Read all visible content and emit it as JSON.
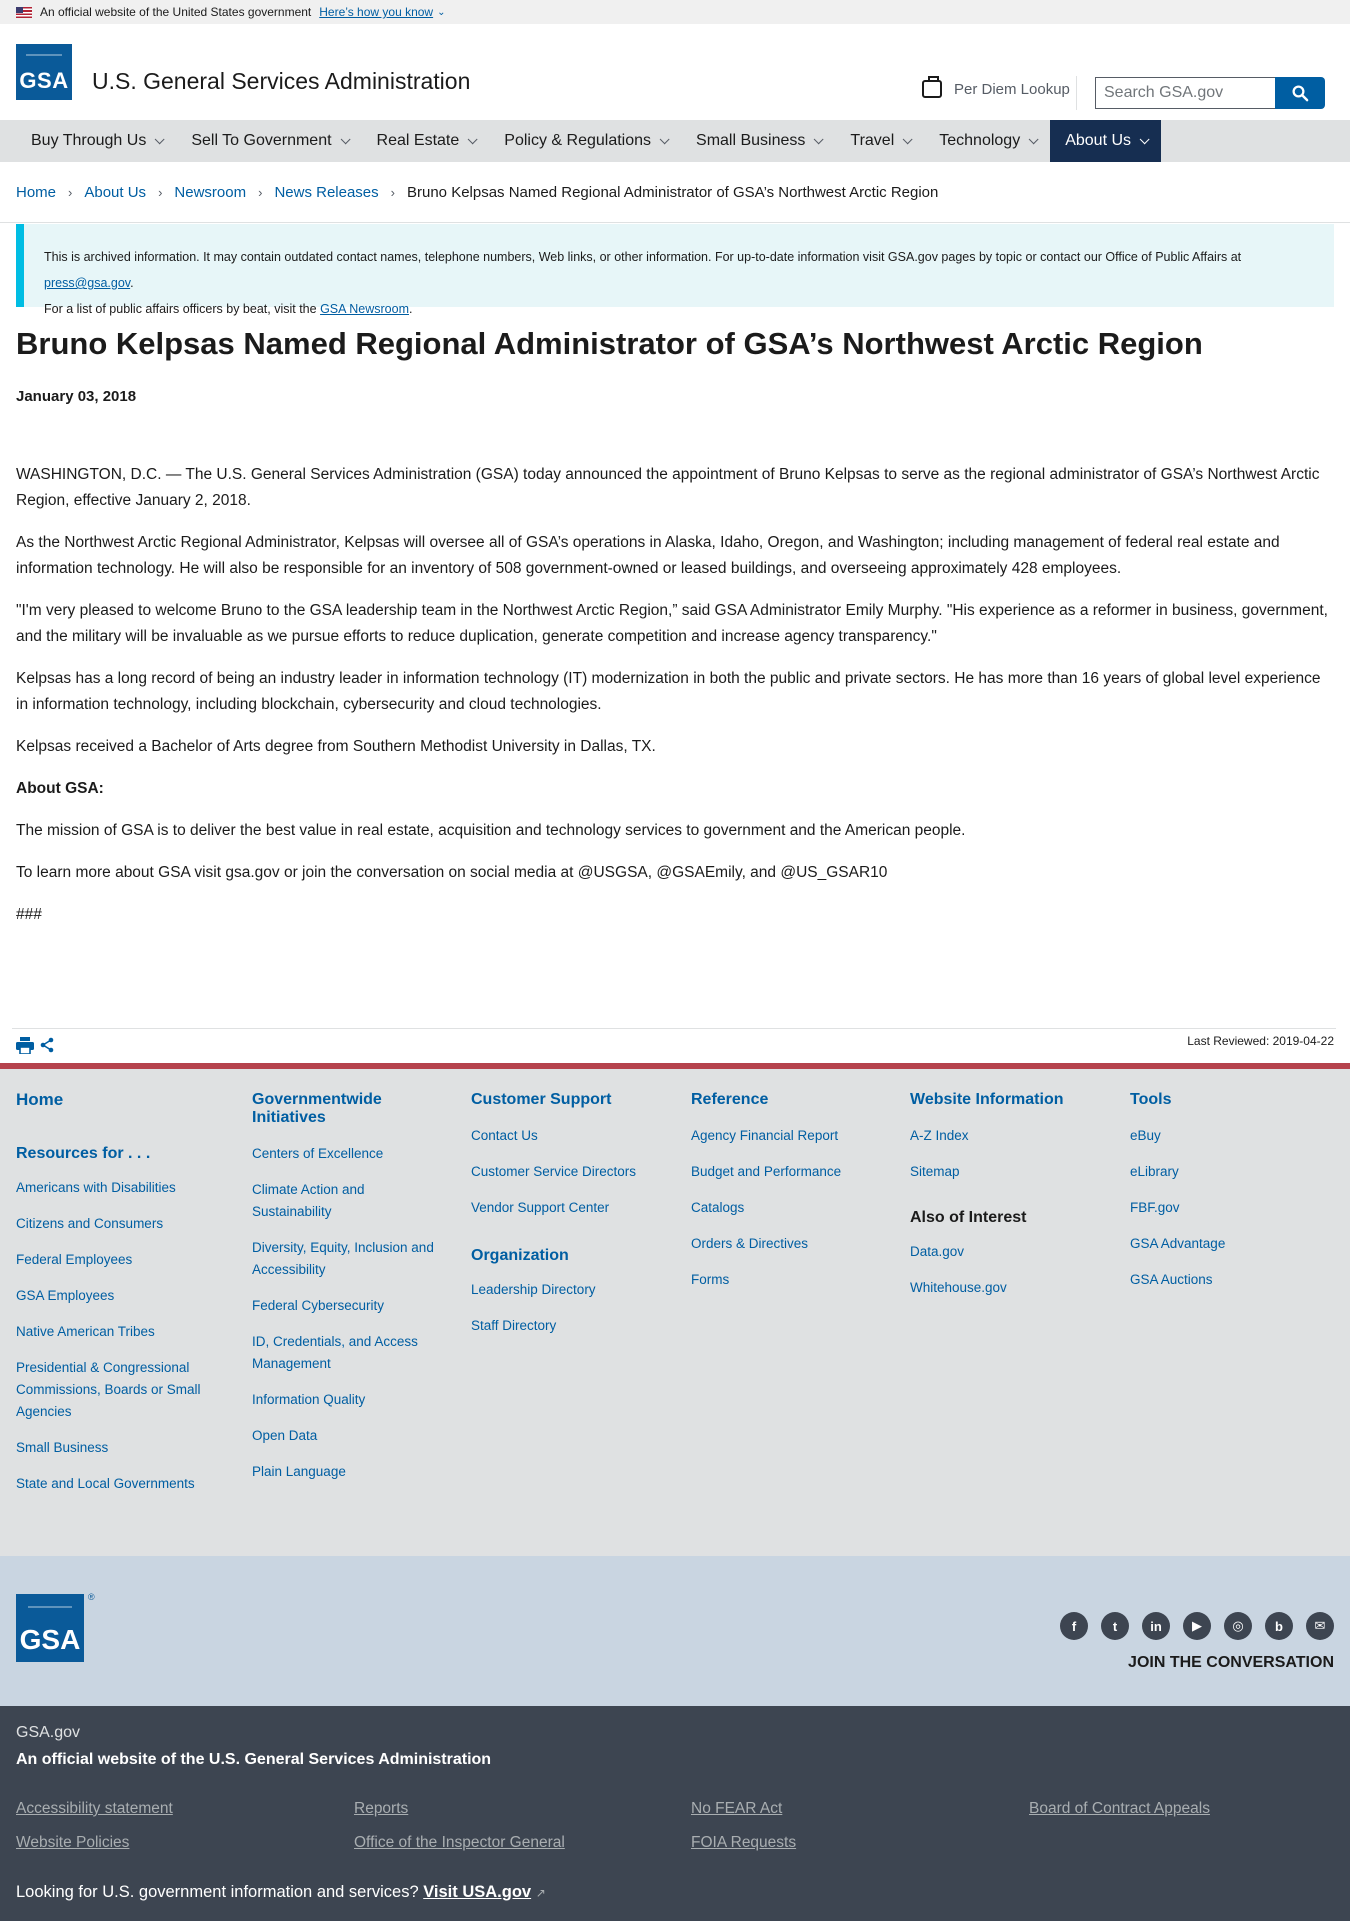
{
  "banner": {
    "text": "An official website of the United States government",
    "link": "Here’s how you know"
  },
  "header": {
    "logo_text": "GSA",
    "agency_name": "U.S. General Services Administration",
    "per_diem": "Per Diem Lookup",
    "search_placeholder": "Search GSA.gov"
  },
  "nav": {
    "items": [
      "Buy Through Us",
      "Sell To Government",
      "Real Estate",
      "Policy & Regulations",
      "Small Business",
      "Travel",
      "Technology",
      "About Us"
    ],
    "active": "About Us"
  },
  "breadcrumb": {
    "items": [
      "Home",
      "About Us",
      "Newsroom",
      "News Releases"
    ],
    "current": "Bruno Kelpsas Named Regional Administrator of GSA’s Northwest Arctic Region"
  },
  "alert": {
    "line1": "This is archived information. It may contain outdated contact names, telephone numbers, Web links, or other information. For up-to-date information visit GSA.gov pages by topic or contact our Office of Public Affairs at",
    "email": "press@gsa.gov",
    "line2": "For a list of public affairs officers by beat, visit the",
    "newsroom_link": "GSA Newsroom"
  },
  "article": {
    "title": "Bruno Kelpsas Named Regional Administrator of GSA’s Northwest Arctic Region",
    "date": "January 03, 2018",
    "p1": "WASHINGTON, D.C. — The U.S. General Services Administration (GSA) today announced the appointment of Bruno Kelpsas to serve as the regional administrator of GSA’s Northwest Arctic Region, effective January 2, 2018.",
    "p2": "As the Northwest Arctic Regional Administrator, Kelpsas will oversee all of GSA’s operations in Alaska, Idaho, Oregon, and Washington; including management of federal real estate and information technology. He will also be responsible for an inventory of 508 government-owned or leased buildings, and overseeing approximately 428 employees.",
    "p3": "\"I'm very pleased to welcome Bruno to the GSA leadership team in the Northwest Arctic Region,” said GSA Administrator Emily Murphy. \"His experience as a reformer in business, government, and the military will be invaluable as we pursue efforts to reduce duplication, generate competition and increase agency transparency.\"",
    "p4": "Kelpsas has a long record of being an industry leader in information technology (IT) modernization in both the public and private sectors. He has more than 16 years of global level experience in information technology, including blockchain, cybersecurity and cloud technologies.",
    "p5": "Kelpsas received a Bachelor of Arts degree from Southern Methodist University in Dallas, TX.",
    "about_heading": "About GSA:",
    "p6": "The mission of GSA is to deliver the best value in real estate, acquisition and technology services to government and the American people.",
    "p7": "To learn more about GSA visit gsa.gov or join the conversation on social media at @USGSA, @GSAEmily, and @US_GSAR10",
    "end": "###",
    "last_reviewed": "Last Reviewed: 2019-04-22"
  },
  "footer": {
    "col1": {
      "home": "Home",
      "heading": "Resources for . . .",
      "links": [
        "Americans with Disabilities",
        "Citizens and Consumers",
        "Federal Employees",
        "GSA Employees",
        "Native American Tribes",
        "Presidential & Congressional Commissions, Boards or Small Agencies",
        "Small Business",
        "State and Local Governments"
      ]
    },
    "col2": {
      "heading": "Governmentwide Initiatives",
      "links": [
        "Centers of Excellence",
        "Climate Action and Sustainability",
        "Diversity, Equity, Inclusion and Accessibility",
        "Federal Cybersecurity",
        "ID, Credentials, and Access Management",
        "Information Quality",
        "Open Data",
        "Plain Language"
      ]
    },
    "col3": {
      "heading": "Customer Support",
      "links": [
        "Contact Us",
        "Customer Service Directors",
        "Vendor Support Center"
      ],
      "heading2": "Organization",
      "links2": [
        "Leadership Directory",
        "Staff Directory"
      ]
    },
    "col4": {
      "heading": "Reference",
      "links": [
        "Agency Financial Report",
        "Budget and Performance",
        "Catalogs",
        "Orders & Directives",
        "Forms"
      ]
    },
    "col5": {
      "heading": "Website Information",
      "links": [
        "A-Z Index",
        "Sitemap"
      ],
      "heading2": "Also of Interest",
      "links2": [
        "Data.gov",
        "Whitehouse.gov"
      ]
    },
    "col6": {
      "heading": "Tools",
      "links": [
        "eBuy",
        "eLibrary",
        "FBF.gov",
        "GSA Advantage",
        "GSA Auctions"
      ]
    },
    "logo_text": "GSA",
    "reg_mark": "®",
    "join": "JOIN THE CONVERSATION",
    "social_icons": [
      "facebook-icon",
      "twitter-icon",
      "linkedin-icon",
      "youtube-icon",
      "instagram-icon",
      "blog-icon",
      "email-icon"
    ],
    "site": "GSA.gov",
    "official": "An official website of the U.S. General Services Administration",
    "bottom_links": [
      "Accessibility statement",
      "Reports",
      "No FEAR Act",
      "Board of Contract Appeals",
      "Website Policies",
      "Office of the Inspector General",
      "FOIA Requests"
    ],
    "usa_text": "Looking for U.S. government information and services?",
    "usa_link": "Visit USA.gov"
  }
}
